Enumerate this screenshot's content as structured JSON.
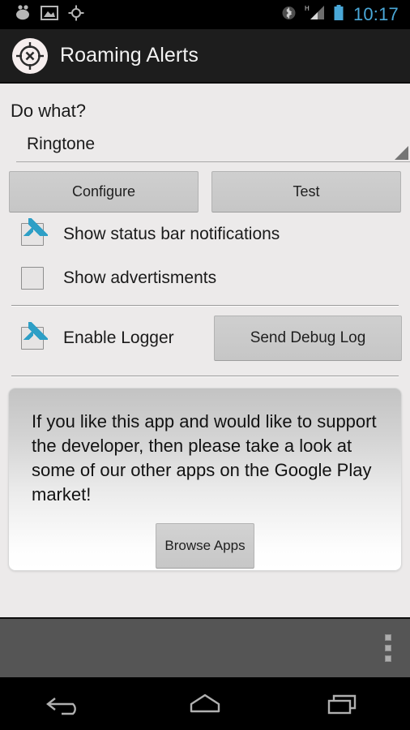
{
  "status_bar": {
    "left_icons": [
      {
        "name": "footprints-icon",
        "label": "footprints"
      },
      {
        "name": "gallery-image-icon",
        "label": "image"
      },
      {
        "name": "gps-location-icon",
        "label": "gps"
      }
    ],
    "right_icons": [
      {
        "name": "bluetooth-icon",
        "label": "bluetooth"
      },
      {
        "name": "signal-hspa-icon",
        "label": "H signal"
      },
      {
        "name": "battery-icon",
        "label": "battery"
      }
    ],
    "clock": "10:17",
    "clock_color": "#4aa8d8"
  },
  "action_bar": {
    "app_icon": "target-crosshair-icon",
    "title": "Roaming Alerts",
    "background": "#1d1d1d"
  },
  "main": {
    "section_label": "Do what?",
    "spinner": {
      "selected_value": "Ringtone",
      "arrow_icon": "spinner-triangle-icon"
    },
    "action_buttons": [
      {
        "name": "configure-button",
        "label": "Configure"
      },
      {
        "name": "test-button",
        "label": "Test"
      }
    ],
    "checkboxes": [
      {
        "name": "show-status-bar-notifications-checkbox",
        "label": "Show status bar notifications",
        "checked": true
      },
      {
        "name": "show-advertisments-checkbox",
        "label": "Show advertisments",
        "checked": false
      }
    ],
    "logger": {
      "checkbox_label": "Enable Logger",
      "checkbox_checked": true,
      "button_label": "Send Debug Log"
    },
    "promo": {
      "text": "If you like this app and would like to support the developer, then please take a look at some of our other apps on the Google Play market!",
      "button_label": "Browse Apps"
    },
    "accent_color": "#2e9fc6",
    "background_color": "#eceaea"
  },
  "system_bar": {
    "overflow_menu": "overflow-menu-icon",
    "background": "#555555"
  },
  "nav_bar": {
    "buttons": [
      {
        "name": "nav-back-button",
        "label": "Back"
      },
      {
        "name": "nav-home-button",
        "label": "Home"
      },
      {
        "name": "nav-recents-button",
        "label": "Recent apps"
      }
    ]
  }
}
